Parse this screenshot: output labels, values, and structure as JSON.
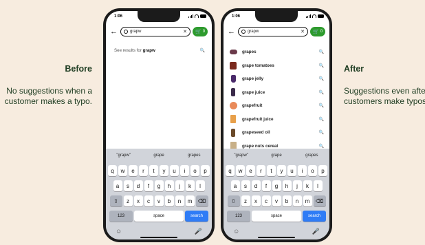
{
  "before": {
    "title": "Before",
    "description": "No suggestions when a customer makes a typo.",
    "status_time": "1:06",
    "search_value": "grapw",
    "cart_count": "0",
    "see_results_prefix": "See results for ",
    "see_results_term": "grapw",
    "predictions": [
      "\"grapw\"",
      "grape",
      "grapes"
    ]
  },
  "after": {
    "title": "After",
    "description": "Suggestions even after customers make typos.",
    "status_time": "1:06",
    "search_value": "grapw",
    "cart_count": "0",
    "suggestions": [
      {
        "label": "grapes",
        "icon": "grapes-thumb-icon"
      },
      {
        "label": "grape tomatoes",
        "icon": "tomato-box-thumb-icon"
      },
      {
        "label": "grape jelly",
        "icon": "jelly-jar-thumb-icon"
      },
      {
        "label": "grape juice",
        "icon": "juice-bottle-thumb-icon"
      },
      {
        "label": "grapefruit",
        "icon": "grapefruit-thumb-icon"
      },
      {
        "label": "grapefruit juice",
        "icon": "juice-carton-thumb-icon"
      },
      {
        "label": "grapeseed oil",
        "icon": "oil-bottle-thumb-icon"
      },
      {
        "label": "grape nuts cereal",
        "icon": "cereal-box-thumb-icon"
      }
    ],
    "predictions": [
      "\"grapw\"",
      "grape",
      "grapes"
    ]
  },
  "keyboard": {
    "row1": [
      "q",
      "w",
      "e",
      "r",
      "t",
      "y",
      "u",
      "i",
      "o",
      "p"
    ],
    "row2": [
      "a",
      "s",
      "d",
      "f",
      "g",
      "h",
      "j",
      "k",
      "l"
    ],
    "row3": [
      "z",
      "x",
      "c",
      "v",
      "b",
      "n",
      "m"
    ],
    "shift": "⇧",
    "backspace": "⌫",
    "numbers": "123",
    "space": "space",
    "search": "search",
    "emoji": "☺",
    "mic": "🎤"
  },
  "colors": {
    "background": "#f7ecdf",
    "text": "#1f3d22",
    "cart_green": "#2d9b2d",
    "search_key_blue": "#2f7cf6"
  }
}
